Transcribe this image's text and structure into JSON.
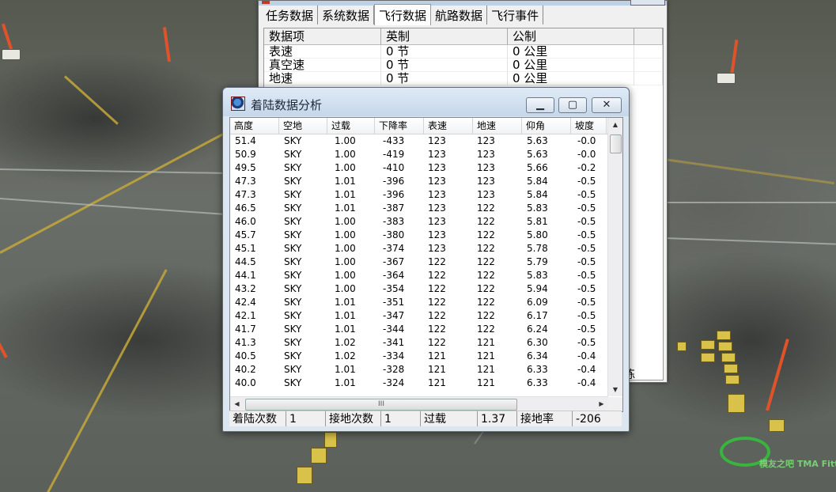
{
  "back_window": {
    "tabs": [
      "任务数据",
      "系统数据",
      "飞行数据",
      "航路数据",
      "飞行事件"
    ],
    "active_tab": 2,
    "columns": [
      "数据项",
      "英制",
      "公制"
    ],
    "rows": [
      {
        "item": "表速",
        "imperial": "0 节",
        "metric": "0 公里"
      },
      {
        "item": "真空速",
        "imperial": "0 节",
        "metric": "0 公里"
      },
      {
        "item": "地速",
        "imperial": "0 节",
        "metric": "0 公里"
      }
    ],
    "partial_text": "练"
  },
  "landing_window": {
    "title": "着陆数据分析",
    "buttons": {
      "minimize": "▁",
      "maximize": "▢",
      "close": "✕"
    },
    "columns": [
      "高度",
      "空地",
      "过载",
      "下降率",
      "表速",
      "地速",
      "仰角",
      "坡度"
    ],
    "rows": [
      [
        "51.4",
        "SKY",
        "1.00",
        "-433",
        "123",
        "123",
        "5.63",
        "-0.0"
      ],
      [
        "50.9",
        "SKY",
        "1.00",
        "-419",
        "123",
        "123",
        "5.63",
        "-0.0"
      ],
      [
        "49.5",
        "SKY",
        "1.00",
        "-410",
        "123",
        "123",
        "5.66",
        "-0.2"
      ],
      [
        "47.3",
        "SKY",
        "1.01",
        "-396",
        "123",
        "123",
        "5.84",
        "-0.5"
      ],
      [
        "47.3",
        "SKY",
        "1.01",
        "-396",
        "123",
        "123",
        "5.84",
        "-0.5"
      ],
      [
        "46.5",
        "SKY",
        "1.01",
        "-387",
        "123",
        "122",
        "5.83",
        "-0.5"
      ],
      [
        "46.0",
        "SKY",
        "1.00",
        "-383",
        "123",
        "122",
        "5.81",
        "-0.5"
      ],
      [
        "45.7",
        "SKY",
        "1.00",
        "-380",
        "123",
        "122",
        "5.80",
        "-0.5"
      ],
      [
        "45.1",
        "SKY",
        "1.00",
        "-374",
        "123",
        "122",
        "5.78",
        "-0.5"
      ],
      [
        "44.5",
        "SKY",
        "1.00",
        "-367",
        "122",
        "122",
        "5.79",
        "-0.5"
      ],
      [
        "44.1",
        "SKY",
        "1.00",
        "-364",
        "122",
        "122",
        "5.83",
        "-0.5"
      ],
      [
        "43.2",
        "SKY",
        "1.00",
        "-354",
        "122",
        "122",
        "5.94",
        "-0.5"
      ],
      [
        "42.4",
        "SKY",
        "1.01",
        "-351",
        "122",
        "122",
        "6.09",
        "-0.5"
      ],
      [
        "42.1",
        "SKY",
        "1.01",
        "-347",
        "122",
        "122",
        "6.17",
        "-0.5"
      ],
      [
        "41.7",
        "SKY",
        "1.01",
        "-344",
        "122",
        "122",
        "6.24",
        "-0.5"
      ],
      [
        "41.3",
        "SKY",
        "1.02",
        "-341",
        "122",
        "121",
        "6.30",
        "-0.5"
      ],
      [
        "40.5",
        "SKY",
        "1.02",
        "-334",
        "121",
        "121",
        "6.34",
        "-0.4"
      ],
      [
        "40.2",
        "SKY",
        "1.01",
        "-328",
        "121",
        "121",
        "6.33",
        "-0.4"
      ],
      [
        "40.0",
        "SKY",
        "1.01",
        "-324",
        "121",
        "121",
        "6.33",
        "-0.4"
      ]
    ],
    "hscroll_grip": "III",
    "status": {
      "landing_count_label": "着陆次数",
      "landing_count": "1",
      "touch_count_label": "接地次数",
      "touch_count": "1",
      "gload_label": "过载",
      "gload": "1.37",
      "touch_rate_label": "接地率",
      "touch_rate": "-206"
    }
  },
  "watermark": {
    "text": "模友之吧 TMA Fitter"
  },
  "colors": {
    "accent": "#32c43a",
    "window_frame": "#dbe6f1",
    "background": "#5d625c"
  }
}
